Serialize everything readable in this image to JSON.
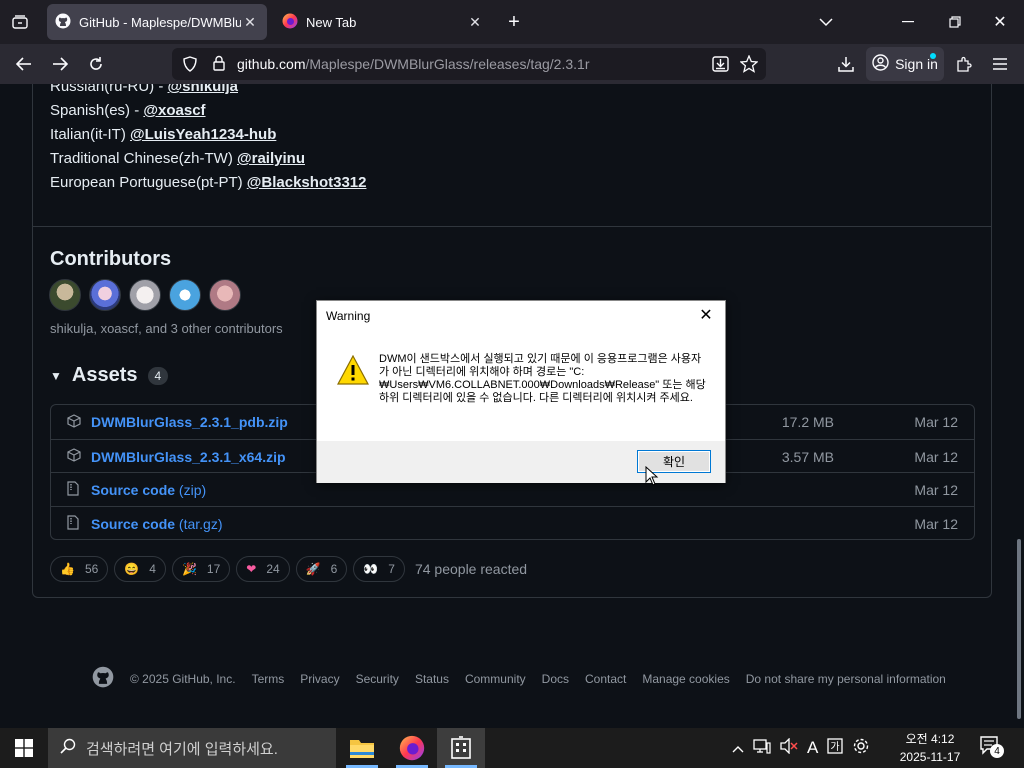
{
  "browser": {
    "tabs": [
      {
        "title": "GitHub - Maplespe/DWMBlurGlass",
        "active": true
      },
      {
        "title": "New Tab",
        "active": false
      }
    ],
    "url_host": "github.com",
    "url_path": "/Maplespe/DWMBlurGlass/releases/tag/2.3.1r",
    "sign_in": "Sign in"
  },
  "translations": [
    {
      "lang": "Russian(ru-RU) - ",
      "user": "@shikulja"
    },
    {
      "lang": "Spanish(es) - ",
      "user": "@xoascf"
    },
    {
      "lang": "Italian(it-IT) ",
      "user": "@LuisYeah1234-hub"
    },
    {
      "lang": "Traditional Chinese(zh-TW) ",
      "user": "@railyinu"
    },
    {
      "lang": "European Portuguese(pt-PT) ",
      "user": "@Blackshot3312"
    }
  ],
  "contributors": {
    "title": "Contributors",
    "summary": "shikulja, xoascf, and 3 other contributors"
  },
  "assets": {
    "title": "Assets",
    "count": "4",
    "items": [
      {
        "name": "DWMBlurGlass_2.3.1_pdb.zip",
        "suffix": "",
        "size": "17.2 MB",
        "date": "Mar 12",
        "icon": "package-icon"
      },
      {
        "name": "DWMBlurGlass_2.3.1_x64.zip",
        "suffix": "",
        "size": "3.57 MB",
        "date": "Mar 12",
        "icon": "package-icon"
      },
      {
        "name": "Source code",
        "suffix": " (zip)",
        "size": "",
        "date": "Mar 12",
        "icon": "file-zip-icon"
      },
      {
        "name": "Source code",
        "suffix": " (tar.gz)",
        "size": "",
        "date": "Mar 12",
        "icon": "file-zip-icon"
      }
    ]
  },
  "reactions": [
    {
      "emoji": "👍",
      "count": "56"
    },
    {
      "emoji": "😄",
      "count": "4"
    },
    {
      "emoji": "🎉",
      "count": "17"
    },
    {
      "emoji": "❤",
      "count": "24"
    },
    {
      "emoji": "🚀",
      "count": "6"
    },
    {
      "emoji": "👀",
      "count": "7"
    }
  ],
  "reaction_summary": "74 people reacted",
  "footer": {
    "copyright": "© 2025 GitHub, Inc.",
    "links": [
      "Terms",
      "Privacy",
      "Security",
      "Status",
      "Community",
      "Docs",
      "Contact",
      "Manage cookies",
      "Do not share my personal information"
    ]
  },
  "dialog": {
    "title": "Warning",
    "message": "DWM이 샌드박스에서 실행되고 있기 때문에 이 응용프로그램은 사용자가 아닌 디렉터리에 위치해야 하며 경로는 \"C:₩Users₩VM6.COLLABNET.000₩Downloads₩Release\" 또는 해당 하위 디렉터리에 있을 수 없습니다. 다른 디렉터리에 위치시켜 주세요.",
    "ok": "확인"
  },
  "taskbar": {
    "search_placeholder": "검색하려면 여기에 입력하세요.",
    "time": "오전 4:12",
    "date": "2025-11-17",
    "notification_count": "4"
  }
}
